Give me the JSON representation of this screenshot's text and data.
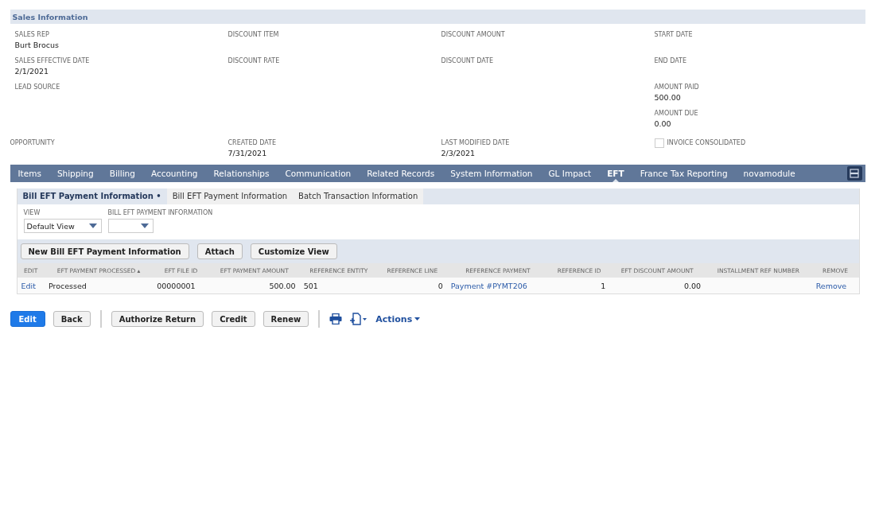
{
  "section": {
    "title": "Sales Information"
  },
  "field_columns": [
    [
      {
        "label": "SALES REP",
        "value": "Burt Brocus"
      },
      {
        "label": "SALES EFFECTIVE DATE",
        "value": "2/1/2021"
      },
      {
        "label": "LEAD SOURCE"
      }
    ],
    [
      {
        "label": "DISCOUNT ITEM"
      },
      {
        "label": "DISCOUNT RATE"
      }
    ],
    [
      {
        "label": "DISCOUNT AMOUNT"
      },
      {
        "label": "DISCOUNT DATE"
      }
    ],
    [
      {
        "label": "START DATE"
      },
      {
        "label": "END DATE"
      },
      {
        "label": "AMOUNT PAID",
        "value": "500.00"
      },
      {
        "label": "AMOUNT DUE",
        "value": "0.00"
      }
    ]
  ],
  "footer_fields": [
    {
      "label": "OPPORTUNITY"
    },
    {
      "label": "CREATED DATE",
      "value": "7/31/2021"
    },
    {
      "label": "LAST MODIFIED DATE",
      "value": "2/3/2021"
    }
  ],
  "invoice_consolidated": {
    "label": "INVOICE CONSOLIDATED",
    "checked": false
  },
  "tabs": [
    {
      "label": "Items",
      "selected": false
    },
    {
      "label": "Shipping",
      "selected": false
    },
    {
      "label": "Billing",
      "selected": false
    },
    {
      "label": "Accounting",
      "selected": false
    },
    {
      "label": "Relationships",
      "selected": false
    },
    {
      "label": "Communication",
      "selected": false
    },
    {
      "label": "Related Records",
      "selected": false
    },
    {
      "label": "System Information",
      "selected": false
    },
    {
      "label": "GL Impact",
      "selected": false
    },
    {
      "label": "EFT",
      "selected": true
    },
    {
      "label": "France Tax Reporting",
      "selected": false
    },
    {
      "label": "novamodule",
      "selected": false
    }
  ],
  "subtabs": [
    {
      "label": "Bill EFT Payment Information •",
      "selected": true
    },
    {
      "label": "Bill EFT Payment Information",
      "selected": false
    },
    {
      "label": "Batch Transaction Information",
      "selected": false
    }
  ],
  "filters": [
    {
      "label": "VIEW",
      "value": "Default View"
    },
    {
      "label": "BILL EFT PAYMENT INFORMATION"
    }
  ],
  "list_buttons": [
    "New Bill EFT Payment Information",
    "Attach",
    "Customize View"
  ],
  "table": {
    "columns": [
      "EDIT",
      "EFT PAYMENT PROCESSED ▴",
      "EFT FILE ID",
      "EFT PAYMENT AMOUNT",
      "REFERENCE ENTITY",
      "REFERENCE LINE",
      "REFERENCE PAYMENT",
      "REFERENCE ID",
      "EFT DISCOUNT AMOUNT",
      "INSTALLMENT REF NUMBER",
      "REMOVE"
    ],
    "rows": [
      [
        {
          "kind": "link",
          "text": "Edit"
        },
        {
          "kind": "text",
          "text": "Processed"
        },
        {
          "kind": "text",
          "text": "00000001"
        },
        {
          "kind": "number",
          "text": "500.00"
        },
        {
          "kind": "text",
          "text": "501"
        },
        {
          "kind": "number",
          "text": "0"
        },
        {
          "kind": "link",
          "text": "Payment #PYMT206"
        },
        {
          "kind": "number",
          "text": "1"
        },
        {
          "kind": "number",
          "text": "0.00"
        },
        {
          "kind": "empty"
        },
        {
          "kind": "link",
          "text": "Remove"
        }
      ]
    ]
  },
  "actions": [
    {
      "label": "Edit",
      "kind": "primary"
    },
    {
      "label": "Back",
      "kind": "default"
    },
    {
      "kind": "divider"
    },
    {
      "label": "Authorize Return",
      "kind": "default"
    },
    {
      "label": "Credit",
      "kind": "default"
    },
    {
      "label": "Renew",
      "kind": "default"
    },
    {
      "kind": "divider"
    }
  ],
  "actions_menu": {
    "label": "Actions"
  }
}
